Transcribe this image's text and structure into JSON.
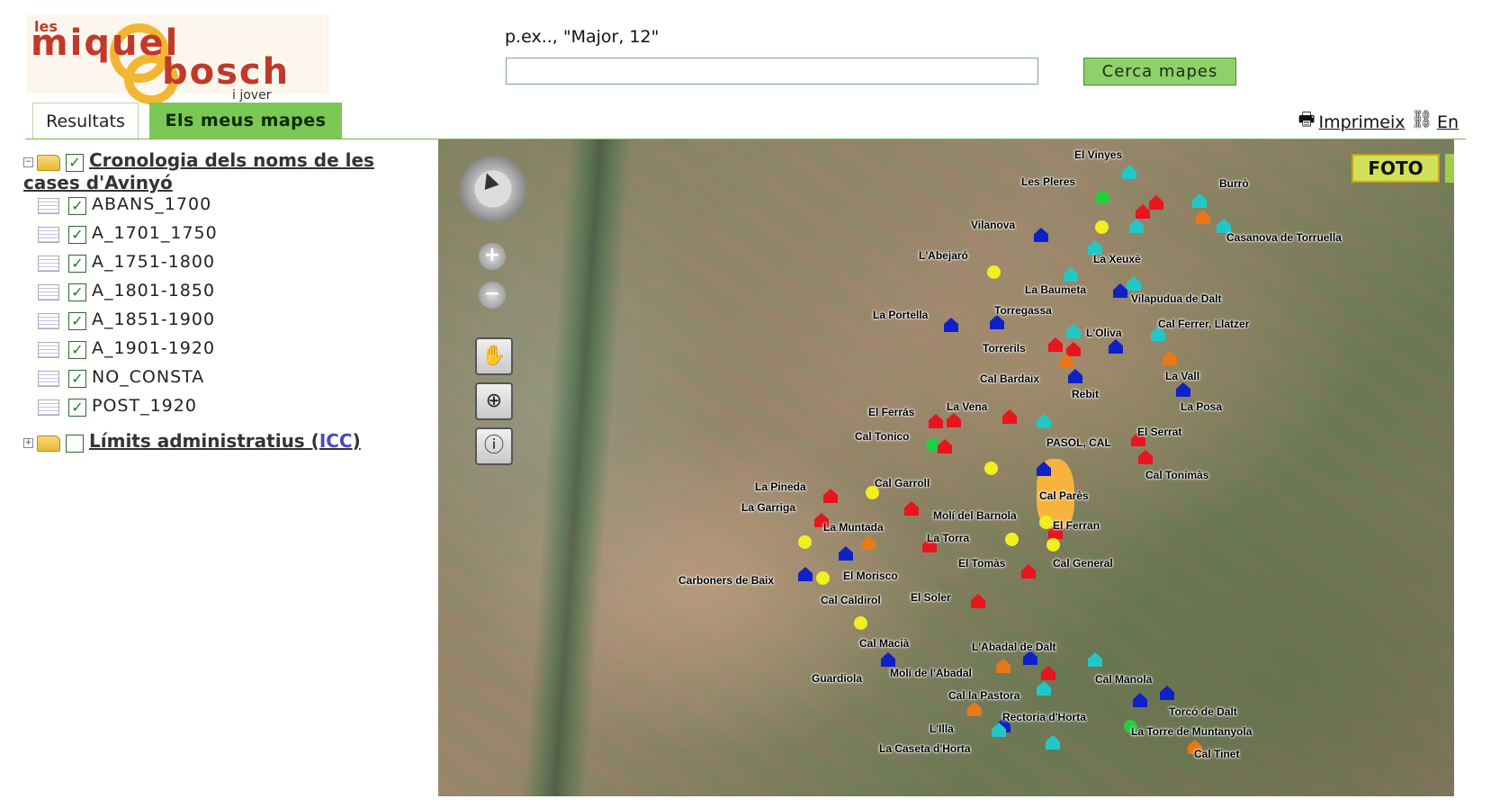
{
  "logo": {
    "les": "les",
    "line1": "miquel",
    "line2": "bosch",
    "tag": "i jover"
  },
  "search": {
    "hint": "p.ex.., \"Major, 12\"",
    "value": "",
    "button": "Cerca mapes"
  },
  "tabs": {
    "results": "Resultats",
    "my_maps": "Els meus mapes"
  },
  "toolbar": {
    "print": "Imprimeix",
    "link": "En"
  },
  "tree": {
    "group1": {
      "label": "Cronologia dels noms de les cases d'Avinyó",
      "checked": true
    },
    "layers": [
      {
        "label": "ABANS_1700",
        "checked": true
      },
      {
        "label": "A_1701_1750",
        "checked": true
      },
      {
        "label": "A_1751-1800",
        "checked": true
      },
      {
        "label": "A_1801-1850",
        "checked": true
      },
      {
        "label": "A_1851-1900",
        "checked": true
      },
      {
        "label": "A_1901-1920",
        "checked": true
      },
      {
        "label": "NO_CONSTA",
        "checked": true
      },
      {
        "label": "POST_1920",
        "checked": true
      }
    ],
    "group2": {
      "label": "Límits administratius (",
      "icc": "ICC",
      "close": ")",
      "checked": false
    }
  },
  "map": {
    "foto_button": "FOTO",
    "colors": {
      "red": "#e8141e",
      "blue": "#1020c8",
      "cyan": "#22c8c8",
      "green": "#20d040",
      "yellow": "#f2ee20",
      "orange": "#e87818"
    },
    "places": [
      "El Vinyes",
      "Les Pleres",
      "Burrò",
      "Vilanova",
      "Casanova de Torruella",
      "L'Abejaró",
      "La Xeuxè",
      "La Baumeta",
      "Vilapudua de Dalt",
      "La Portella",
      "Torregassa",
      "Cal Ferrer, Llatzer",
      "L'Oliva",
      "Torrerils",
      "La Vall",
      "Cal Bardaix",
      "Rebit",
      "La Posa",
      "El Ferrás",
      "La Vena",
      "El Serrat",
      "Cal Tonico",
      "PASOL, CAL",
      "Cal Tonimàs",
      "La Pineda",
      "Cal Garroll",
      "Cal Parès",
      "La Garriga",
      "Molí del Barnola",
      "El Ferran",
      "La Muntada",
      "La Torra",
      "El Tomàs",
      "Cal General",
      "Carboners de Baix",
      "El Morisco",
      "Cal Caldirol",
      "El Soler",
      "Cal Macià",
      "L'Abadal de Dalt",
      "Guardiola",
      "Molí de l'Abadal",
      "Cal Manola",
      "Cal la Pastora",
      "Torcó de Dalt",
      "Rectoria d'Horta",
      "L'Illa",
      "La Torre de Muntanyola",
      "La Caseta d'Horta",
      "Cal Tinet"
    ]
  }
}
